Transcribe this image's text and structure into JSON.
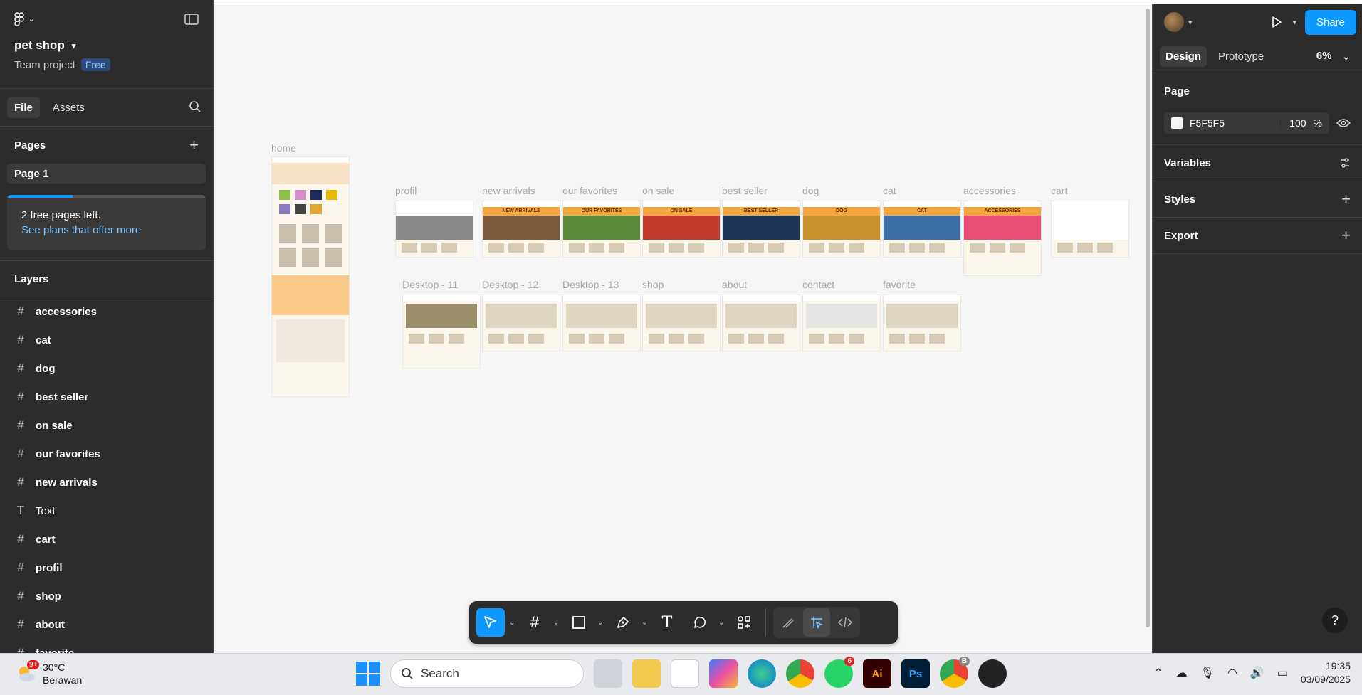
{
  "project": {
    "name": "pet shop",
    "team": "Team project",
    "plan": "Free"
  },
  "left_tabs": {
    "file": "File",
    "assets": "Assets"
  },
  "pages": {
    "heading": "Pages",
    "items": [
      "Page 1"
    ]
  },
  "promo": {
    "text": "2 free pages left.",
    "link": "See plans that offer more",
    "progress": 0.33
  },
  "layers": {
    "heading": "Layers",
    "items": [
      {
        "icon": "#",
        "label": "accessories"
      },
      {
        "icon": "#",
        "label": "cat"
      },
      {
        "icon": "#",
        "label": "dog"
      },
      {
        "icon": "#",
        "label": "best seller"
      },
      {
        "icon": "#",
        "label": "on sale"
      },
      {
        "icon": "#",
        "label": "our favorites"
      },
      {
        "icon": "#",
        "label": "new arrivals"
      },
      {
        "icon": "T",
        "label": "Text"
      },
      {
        "icon": "#",
        "label": "cart"
      },
      {
        "icon": "#",
        "label": "profil"
      },
      {
        "icon": "#",
        "label": "shop"
      },
      {
        "icon": "#",
        "label": "about"
      },
      {
        "icon": "#",
        "label": "favorite"
      }
    ]
  },
  "frames": {
    "home": "home",
    "row1": [
      "profil",
      "new arrivals",
      "our favorites",
      "on sale",
      "best seller",
      "dog",
      "cat",
      "accessories",
      "cart"
    ],
    "row2": [
      "Desktop - 11",
      "Desktop - 12",
      "Desktop - 13",
      "shop",
      "about",
      "contact",
      "favorite"
    ],
    "banners": [
      "",
      "NEW ARRIVALS",
      "OUR FAVORITES",
      "ON SALE",
      "BEST SELLER",
      "DOG",
      "CAT",
      "ACCESSORIES",
      ""
    ]
  },
  "right": {
    "share": "Share",
    "tabs": {
      "design": "Design",
      "prototype": "Prototype"
    },
    "zoom": "6%",
    "page_heading": "Page",
    "fill_hex": "F5F5F5",
    "fill_opacity": "100",
    "fill_unit": "%",
    "variables": "Variables",
    "styles": "Styles",
    "export": "Export",
    "help": "?"
  },
  "taskbar": {
    "temp": "30°C",
    "weather": "Berawan",
    "weather_badge": "9+",
    "search": "Search",
    "whatsapp_badge": "6",
    "chrome2_badge": "B",
    "time": "19:35",
    "date": "03/09/2025"
  },
  "colors": {
    "accent": "#0d99ff",
    "panel": "#2c2c2c",
    "canvas": "#f5f5f5"
  }
}
